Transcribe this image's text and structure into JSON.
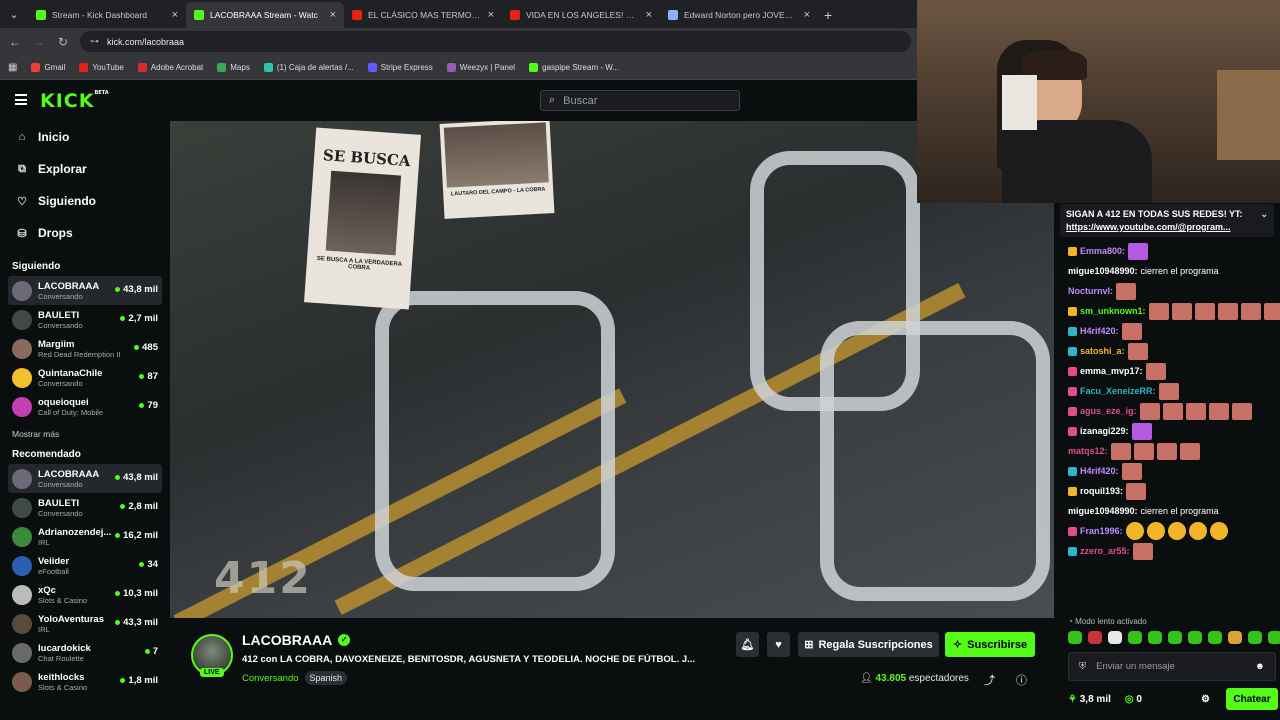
{
  "browser": {
    "tabs": [
      {
        "title": "Stream - Kick Dashboard",
        "color": "#53fc18",
        "active": false
      },
      {
        "title": "LACOBRAAA Stream - Watc",
        "color": "#53fc18",
        "active": true
      },
      {
        "title": "EL CLÁSICO MAS TERMO DEL C",
        "color": "#e62117",
        "active": false
      },
      {
        "title": "VIDA EN LOS ANGELES! VEGET",
        "color": "#e62117",
        "active": false
      },
      {
        "title": "Edward Norton pero JOVEN - E",
        "color": "#8ab4f8",
        "active": false
      }
    ],
    "url": "kick.com/lacobraaa",
    "bookmarks": [
      {
        "label": "Gmail",
        "color": "#ea4335"
      },
      {
        "label": "YouTube",
        "color": "#e62117"
      },
      {
        "label": "Adobe Acrobat",
        "color": "#d62c2c"
      },
      {
        "label": "Maps",
        "color": "#34a853"
      },
      {
        "label": "(1) Caja de alertas /...",
        "color": "#31c3a5"
      },
      {
        "label": "Stripe Express",
        "color": "#635bff"
      },
      {
        "label": "Weezyx | Panel",
        "color": "#9b59b6"
      },
      {
        "label": "gaspipe Stream - W...",
        "color": "#53fc18"
      }
    ]
  },
  "header": {
    "logo": "KICK",
    "logo_badge": "BETA",
    "search_placeholder": "Buscar"
  },
  "sidebar": {
    "nav": [
      {
        "label": "Inicio",
        "icon": "⌂"
      },
      {
        "label": "Explorar",
        "icon": "⧉"
      },
      {
        "label": "Siguiendo",
        "icon": "♡"
      },
      {
        "label": "Drops",
        "icon": "⛁"
      }
    ],
    "following_title": "Siguiendo",
    "following": [
      {
        "name": "LACOBRAAA",
        "category": "Conversando",
        "viewers": "43,8 mil",
        "color": "#6d6a78",
        "selected": true
      },
      {
        "name": "BAULETI",
        "category": "Conversando",
        "viewers": "2,7 mil",
        "color": "#3f4a45",
        "selected": false
      },
      {
        "name": "Margiim",
        "category": "Red Dead Redemption II",
        "viewers": "485",
        "color": "#8a6a5a",
        "selected": false
      },
      {
        "name": "QuintanaChile",
        "category": "Conversando",
        "viewers": "87",
        "color": "#f2c12e",
        "selected": false
      },
      {
        "name": "oqueioquei",
        "category": "Call of Duty: Mobile",
        "viewers": "79",
        "color": "#c13fb0",
        "selected": false
      }
    ],
    "show_more": "Mostrar más",
    "recommended_title": "Recomendado",
    "recommended": [
      {
        "name": "LACOBRAAA",
        "category": "Conversando",
        "viewers": "43,8 mil",
        "color": "#6d6a78",
        "selected": true
      },
      {
        "name": "BAULETI",
        "category": "Conversando",
        "viewers": "2,8 mil",
        "color": "#3f4a45",
        "selected": false
      },
      {
        "name": "Adrianozendej...",
        "category": "IRL",
        "viewers": "16,2 mil",
        "color": "#3a8a3a",
        "selected": false
      },
      {
        "name": "Veiider",
        "category": "eFootball",
        "viewers": "34",
        "color": "#2c5fb0",
        "selected": false
      },
      {
        "name": "xQc",
        "category": "Slots & Casino",
        "viewers": "10,3 mil",
        "color": "#bbbbbb",
        "selected": false
      },
      {
        "name": "YoloAventuras",
        "category": "IRL",
        "viewers": "43,3 mil",
        "color": "#5a4a3a",
        "selected": false
      },
      {
        "name": "lucardokick",
        "category": "Chat Roulette",
        "viewers": "7",
        "color": "#6a6a6a",
        "selected": false
      },
      {
        "name": "keithlocks",
        "category": "Slots & Casino",
        "viewers": "1,8 mil",
        "color": "#7a5a4a",
        "selected": false
      }
    ]
  },
  "video": {
    "poster1_line1": "SE BUSCA",
    "poster1_line2": "SE BUSCA A LA VERDADERA COBRA",
    "poster2_caption": "LAUTARO DEL CAMPO - LA COBRA",
    "watermark": "412"
  },
  "stream": {
    "channel": "LACOBRAAA",
    "live_label": "LIVE",
    "title": "412 con LA COBRA, DAVOXENEIZE, BENITOSDR, AGUSNETA Y TEODELIA. NOCHE DE FÚTBOL. J...",
    "category": "Conversando",
    "tag": "Spanish",
    "gift_label": "Regala Suscripciones",
    "subscribe_label": "Suscribirse",
    "viewers_count": "43.805",
    "viewers_label": "espectadores"
  },
  "chat": {
    "pinned_text": "SIGAN A 412 EN TODAS SUS REDES! YT:",
    "pinned_link": "https://www.youtube.com/@program...",
    "messages": [
      {
        "user": "Emma800:",
        "color": "#c28bff",
        "text": "",
        "emotes": "p",
        "badge": "#f2b52a"
      },
      {
        "user": "migue10948990:",
        "color": "#ffffff",
        "text": "cierren el programa",
        "emotes": "",
        "badge": ""
      },
      {
        "user": "Nocturnvl:",
        "color": "#c28bff",
        "text": "",
        "emotes": "r",
        "badge": ""
      },
      {
        "user": "sm_unknown1:",
        "color": "#53fc18",
        "text": "",
        "emotes": "rrrrrr",
        "badge": "#f2b52a"
      },
      {
        "user": "H4rif420:",
        "color": "#c28bff",
        "text": "",
        "emotes": "r",
        "badge": "#2fb5c7"
      },
      {
        "user": "satoshi_a:",
        "color": "#f2b52a",
        "text": "",
        "emotes": "r",
        "badge": "#2fb5c7"
      },
      {
        "user": "emma_mvp17:",
        "color": "#ffffff",
        "text": "",
        "emotes": "r",
        "badge": "#e24c8c"
      },
      {
        "user": "Facu_XeneizeRR:",
        "color": "#2fb5c7",
        "text": "",
        "emotes": "r",
        "badge": "#e24c8c"
      },
      {
        "user": "agus_eze_ig:",
        "color": "#e24c8c",
        "text": "",
        "emotes": "rrrrr",
        "badge": "#e24c8c"
      },
      {
        "user": "izanagi229:",
        "color": "#ffffff",
        "text": "",
        "emotes": "p",
        "badge": "#e24c8c"
      },
      {
        "user": "matqs12:",
        "color": "#e24c8c",
        "text": "",
        "emotes": "rrrr",
        "badge": ""
      },
      {
        "user": "H4rif420:",
        "color": "#c28bff",
        "text": "",
        "emotes": "r",
        "badge": "#2fb5c7"
      },
      {
        "user": "roquil193:",
        "color": "#ffffff",
        "text": "",
        "emotes": "r",
        "badge": "#f2b52a"
      },
      {
        "user": "migue10948990:",
        "color": "#ffffff",
        "text": "cierren el programa",
        "emotes": "",
        "badge": ""
      },
      {
        "user": "Fran1996:",
        "color": "#c28bff",
        "text": "",
        "emotes": "yyyyy",
        "badge": "#e24c8c"
      },
      {
        "user": "zzero_ar55:",
        "color": "#e24c8c",
        "text": "",
        "emotes": "r",
        "badge": "#2fb5c7"
      }
    ],
    "slow_mode": "Modo lento activado",
    "input_placeholder": "Enviar un mensaje",
    "points": "3,8 mil",
    "kicks": "0",
    "send_label": "Chatear"
  }
}
